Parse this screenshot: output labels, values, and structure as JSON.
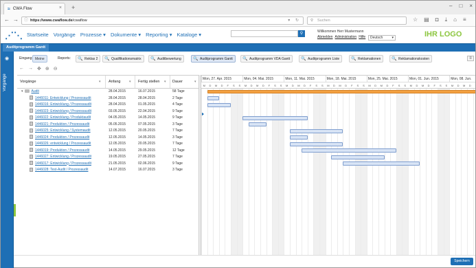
{
  "browser": {
    "tab_title": "CWA Flow",
    "url_host": "https://www.cwaflow.de",
    "url_path": "/cwaflow",
    "search_placeholder": "Suchen"
  },
  "app": {
    "brand_icon": "network-logo-icon",
    "nav": [
      "Startseite",
      "Vorgänge",
      "Prozesse ▾",
      "Dokumente ▾",
      "Reporting ▾",
      "Kataloge ▾"
    ],
    "welcome": "Willkommen Herr Mustermann",
    "links": [
      "Abmelden",
      "Administration",
      "Hilfe"
    ],
    "language": "Deutsch",
    "logo": "IHR LOGO",
    "app_tab": "Auditprogramm Gantt",
    "sidebar_label": "Vorgänge"
  },
  "reports": {
    "eingang_label": "Eingang:",
    "meine_label": "Meine",
    "reports_label": "Reports:",
    "buttons": [
      "Reklas 2",
      "Qualifikationsmatrix",
      "Auditbewertung",
      "Auditprogramm Gantt",
      "Auditprogramm VDA Gantt",
      "Auditprogramm Liste",
      "Reklamationen",
      "Reklamationskosten"
    ]
  },
  "grid": {
    "headers": [
      "Vorgänge",
      "Anfang",
      "Fertig stellen",
      "Dauer"
    ],
    "rows": [
      {
        "name": "Audit",
        "start": "28.04.2015",
        "end": "16.07.2015",
        "dur": "58 Tage",
        "group": true
      },
      {
        "name": "1446011: Entwicklung / Prozessaudit",
        "start": "28.04.2015",
        "end": "28.04.2015",
        "dur": "2 Tage"
      },
      {
        "name": "1446016: Entwicklung / Prozessaudit",
        "start": "28.04.2015",
        "end": "01.05.2015",
        "dur": "4 Tage"
      },
      {
        "name": "1446023: Entwicklung / Prozessaudit",
        "start": "03.05.2015",
        "end": "22.04.2015",
        "dur": "9 Tage"
      },
      {
        "name": "1446022: Entwicklung / Produktaudit",
        "start": "04.05.2015",
        "end": "14.05.2015",
        "dur": "9 Tage"
      },
      {
        "name": "1446021: Produktion / Prozessaudit",
        "start": "05.05.2015",
        "end": "07.05.2015",
        "dur": "3 Tage"
      },
      {
        "name": "1446025: Entwicklung / Systemaudit",
        "start": "12.05.2015",
        "end": "20.05.2015",
        "dur": "7 Tage"
      },
      {
        "name": "1446024: Produktion / Prozessaudit",
        "start": "12.05.2015",
        "end": "14.05.2015",
        "dur": "3 Tage"
      },
      {
        "name": "1446026: entwicklung / Prozessaudit",
        "start": "12.05.2015",
        "end": "20.05.2015",
        "dur": "7 Tage"
      },
      {
        "name": "1446019: Produktion / Prozessaudit",
        "start": "14.05.2015",
        "end": "29.05.2015",
        "dur": "12 Tage"
      },
      {
        "name": "1446027: Entwicklung / Prozessaudit",
        "start": "19.05.2015",
        "end": "27.05.2015",
        "dur": "7 Tage"
      },
      {
        "name": "1446017: Entwicklung / Prozessaudit",
        "start": "21.05.2015",
        "end": "02.06.2015",
        "dur": "9 Tage"
      },
      {
        "name": "1446028: Test-Audit / Prozessaudit",
        "start": "14.07.2015",
        "end": "16.07.2015",
        "dur": "3 Tage"
      }
    ]
  },
  "gantt": {
    "weeks": [
      "Mon, 27. Apr. 2015",
      "Mon, 04. Mai. 2015",
      "Mon, 11. Mai. 2015",
      "Mon, 18. Mai. 2015",
      "Mon, 25. Mai. 2015",
      "Mon, 01. Jun. 2015",
      "Mon, 08. Jun."
    ],
    "day_letters": [
      "M",
      "D",
      "M",
      "D",
      "F",
      "S",
      "S"
    ],
    "first_date": "27.04.2015",
    "main_bar": {
      "start": "28.04.2015",
      "end": "16.07.2015"
    },
    "bars": [
      {
        "start": "28.04.2015",
        "end": "29.04.2015"
      },
      {
        "start": "28.04.2015",
        "end": "01.05.2015"
      },
      null,
      {
        "start": "04.05.2015",
        "end": "14.05.2015"
      },
      {
        "start": "05.05.2015",
        "end": "07.05.2015"
      },
      {
        "start": "12.05.2015",
        "end": "20.05.2015"
      },
      {
        "start": "12.05.2015",
        "end": "14.05.2015"
      },
      {
        "start": "12.05.2015",
        "end": "20.05.2015"
      },
      {
        "start": "14.05.2015",
        "end": "29.05.2015"
      },
      {
        "start": "19.05.2015",
        "end": "27.05.2015"
      },
      {
        "start": "21.05.2015",
        "end": "02.06.2015"
      }
    ]
  },
  "footer": {
    "save_label": "Speichern"
  }
}
